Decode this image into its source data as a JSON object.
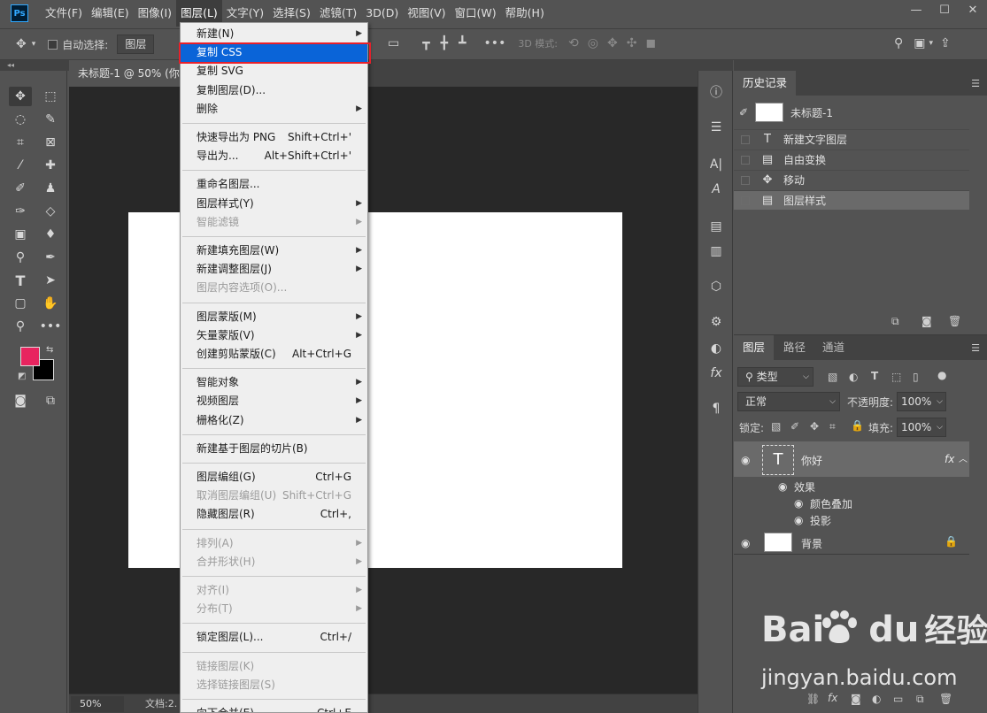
{
  "menubar": {
    "logo": "Ps",
    "items": [
      "文件(F)",
      "编辑(E)",
      "图像(I)",
      "图层(L)",
      "文字(Y)",
      "选择(S)",
      "滤镜(T)",
      "3D(D)",
      "视图(V)",
      "窗口(W)",
      "帮助(H)"
    ],
    "active_index": 3,
    "window_controls": [
      "—",
      "☐",
      "✕"
    ]
  },
  "options_bar": {
    "auto_select_label": "自动选择:",
    "auto_select_value": "图层",
    "mode_3d_label": "3D 模式:"
  },
  "document": {
    "tab_title": "未标题-1 @ 50% (你",
    "zoom": "50%",
    "doc_info": "文档:2."
  },
  "history": {
    "tabs": [
      "历史记录"
    ],
    "snapshot": "未标题-1",
    "steps": [
      {
        "icon": "text-icon",
        "glyph": "T",
        "label": "新建文字图层"
      },
      {
        "icon": "document-icon",
        "glyph": "▤",
        "label": "自由变换"
      },
      {
        "icon": "move-icon",
        "glyph": "✥",
        "label": "移动"
      },
      {
        "icon": "document-icon",
        "glyph": "▤",
        "label": "图层样式"
      }
    ],
    "selected_index": 3
  },
  "layers": {
    "tabs": [
      "图层",
      "路径",
      "通道"
    ],
    "filter_type": "类型",
    "blend_mode": "正常",
    "opacity_label": "不透明度:",
    "opacity_value": "100%",
    "lock_label": "锁定:",
    "fill_label": "填充:",
    "fill_value": "100%",
    "text_layer": {
      "name": "你好",
      "fx": "fx",
      "thumb": "T"
    },
    "effects_label": "效果",
    "effects": [
      "颜色叠加",
      "投影"
    ],
    "background_layer": {
      "name": "背景"
    }
  },
  "dropdown": {
    "items": [
      {
        "label": "新建(N)",
        "sub": true
      },
      {
        "label": "复制 CSS",
        "highlight": true
      },
      {
        "label": "复制 SVG"
      },
      {
        "label": "复制图层(D)..."
      },
      {
        "label": "删除",
        "sub": true
      },
      {
        "sep": true
      },
      {
        "label": "快速导出为 PNG",
        "shortcut": "Shift+Ctrl+'"
      },
      {
        "label": "导出为...",
        "shortcut": "Alt+Shift+Ctrl+'"
      },
      {
        "sep": true
      },
      {
        "label": "重命名图层..."
      },
      {
        "label": "图层样式(Y)",
        "sub": true
      },
      {
        "label": "智能滤镜",
        "sub": true,
        "disabled": true
      },
      {
        "sep": true
      },
      {
        "label": "新建填充图层(W)",
        "sub": true
      },
      {
        "label": "新建调整图层(J)",
        "sub": true
      },
      {
        "label": "图层内容选项(O)...",
        "disabled": true
      },
      {
        "sep": true
      },
      {
        "label": "图层蒙版(M)",
        "sub": true
      },
      {
        "label": "矢量蒙版(V)",
        "sub": true
      },
      {
        "label": "创建剪贴蒙版(C)",
        "shortcut": "Alt+Ctrl+G"
      },
      {
        "sep": true
      },
      {
        "label": "智能对象",
        "sub": true
      },
      {
        "label": "视频图层",
        "sub": true
      },
      {
        "label": "栅格化(Z)",
        "sub": true
      },
      {
        "sep": true
      },
      {
        "label": "新建基于图层的切片(B)"
      },
      {
        "sep": true
      },
      {
        "label": "图层编组(G)",
        "shortcut": "Ctrl+G"
      },
      {
        "label": "取消图层编组(U)",
        "shortcut": "Shift+Ctrl+G",
        "disabled": true
      },
      {
        "label": "隐藏图层(R)",
        "shortcut": "Ctrl+,"
      },
      {
        "sep": true
      },
      {
        "label": "排列(A)",
        "sub": true,
        "disabled": true
      },
      {
        "label": "合并形状(H)",
        "sub": true,
        "disabled": true
      },
      {
        "sep": true
      },
      {
        "label": "对齐(I)",
        "sub": true,
        "disabled": true
      },
      {
        "label": "分布(T)",
        "sub": true,
        "disabled": true
      },
      {
        "sep": true
      },
      {
        "label": "锁定图层(L)...",
        "shortcut": "Ctrl+/"
      },
      {
        "sep": true
      },
      {
        "label": "链接图层(K)",
        "disabled": true
      },
      {
        "label": "选择链接图层(S)",
        "disabled": true
      },
      {
        "sep": true
      },
      {
        "label": "向下合并(E)",
        "shortcut": "Ctrl+E"
      }
    ]
  },
  "colors": {
    "foreground": "#e8245f",
    "background": "#000000"
  },
  "watermark": {
    "logo_text": "Bai",
    "logo_text2": "du",
    "logo_cn": "经验",
    "url": "jingyan.baidu.com"
  }
}
